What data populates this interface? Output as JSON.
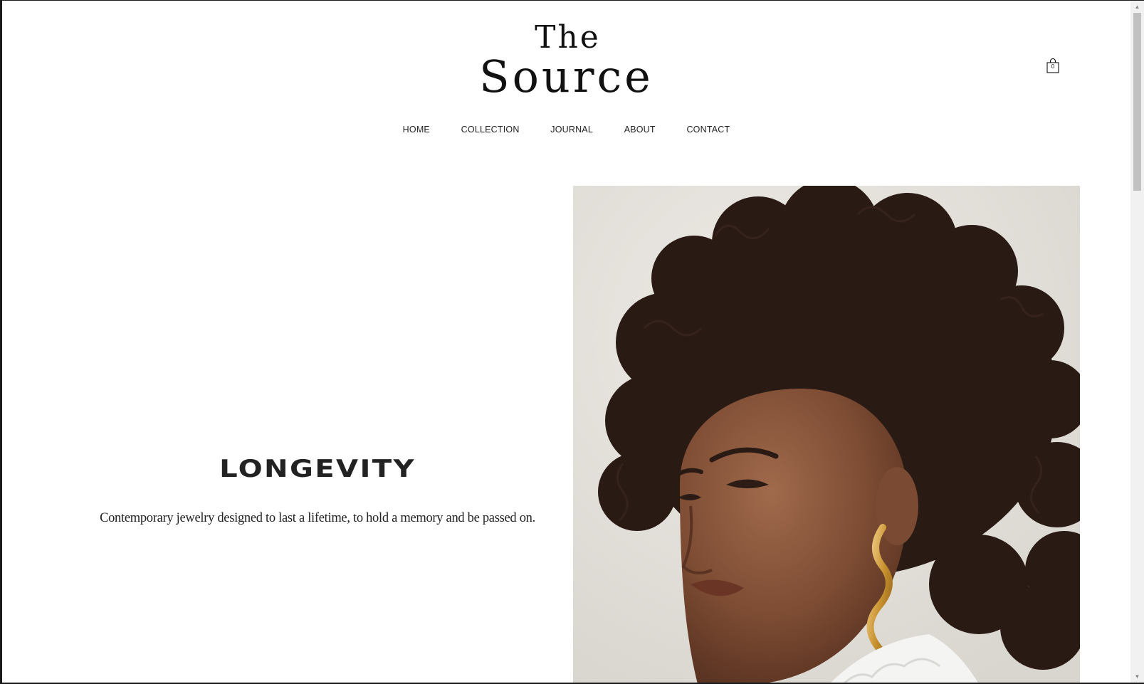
{
  "logo": {
    "line1": "The",
    "line2": "Source"
  },
  "cart": {
    "icon": "shopping-bag-icon",
    "count": "0"
  },
  "nav": {
    "items": [
      {
        "label": "HOME"
      },
      {
        "label": "COLLECTION"
      },
      {
        "label": "JOURNAL"
      },
      {
        "label": "ABOUT"
      },
      {
        "label": "CONTACT"
      }
    ]
  },
  "hero": {
    "headline": "LONGEVITY",
    "subtext": "Contemporary jewelry designed to last a lifetime, to hold a memory and be passed on."
  },
  "scrollbar": {
    "up_icon": "scroll-up-arrow-icon",
    "down_icon": "scroll-down-arrow-icon"
  }
}
